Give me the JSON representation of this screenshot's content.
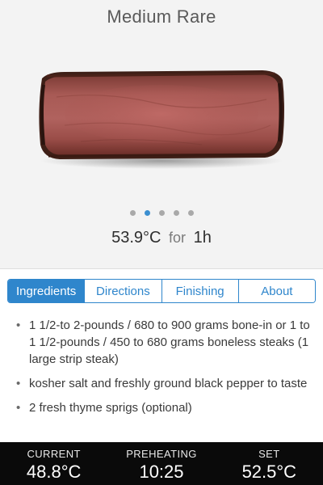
{
  "hero": {
    "title": "Medium Rare",
    "temperature": "53.9°C",
    "for_word": "for",
    "duration": "1h",
    "image": "medium-rare-steak-cross-section",
    "carousel": {
      "count": 5,
      "active_index": 1
    }
  },
  "tabs": [
    {
      "label": "Ingredients",
      "active": true
    },
    {
      "label": "Directions",
      "active": false
    },
    {
      "label": "Finishing",
      "active": false
    },
    {
      "label": "About",
      "active": false
    }
  ],
  "ingredients": [
    "1 1/2-to 2-pounds / 680 to 900 grams bone-in or 1 to 1 1/2-pounds / 450 to 680 grams boneless steaks (1 large strip steak)",
    "kosher salt and freshly ground black pepper to taste",
    "2 fresh thyme sprigs (optional)"
  ],
  "footer": {
    "current": {
      "label": "CURRENT",
      "value": "48.8°C"
    },
    "status": {
      "label": "PREHEATING",
      "value": "10:25"
    },
    "set": {
      "label": "SET",
      "value": "52.5°C"
    }
  },
  "colors": {
    "accent": "#2f86cc",
    "hero_background": "#f3f3f3",
    "footer_background": "#0a0a0a"
  }
}
